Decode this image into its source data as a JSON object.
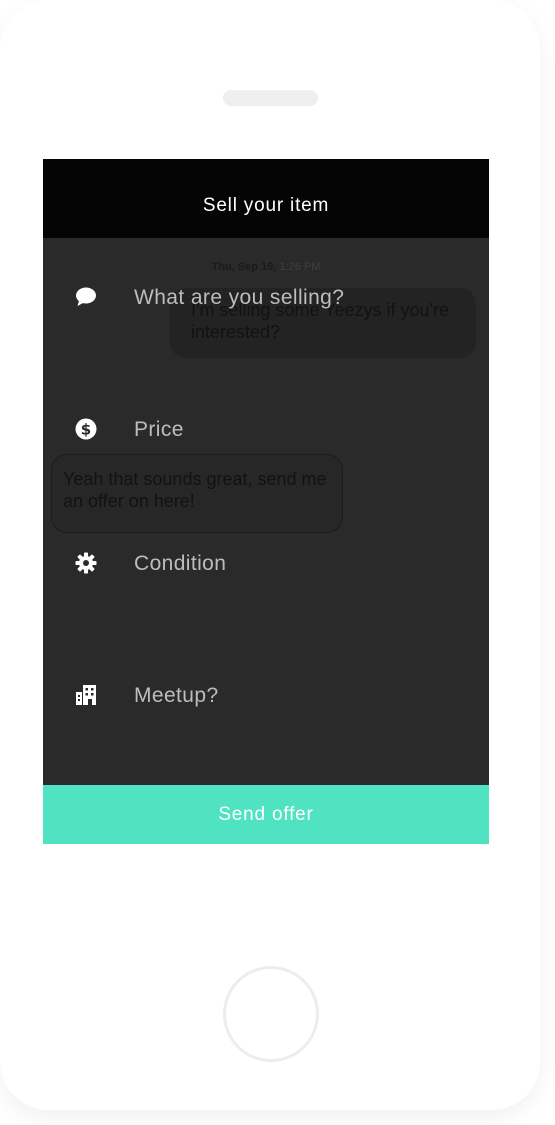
{
  "header": {
    "title": "Sell your item"
  },
  "chat": {
    "date": "Thu, Sep 19,",
    "time": "1:26 PM",
    "outgoing_message": "I'm selling some Yeezys if you're interested?",
    "incoming_message": "Yeah that sounds great, send me an offer on here!"
  },
  "form": {
    "rows": [
      {
        "label": "What are you selling?",
        "icon": "speech-bubble-icon"
      },
      {
        "label": "Price",
        "icon": "dollar-coin-icon"
      },
      {
        "label": "Condition",
        "icon": "gear-icon"
      },
      {
        "label": "Meetup?",
        "icon": "building-icon"
      }
    ]
  },
  "actions": {
    "send_label": "Send offer"
  },
  "colors": {
    "header_bg": "#050505",
    "screen_bg": "#2a2a2a",
    "accent": "#50e3c2",
    "label": "#bdbdbd"
  }
}
